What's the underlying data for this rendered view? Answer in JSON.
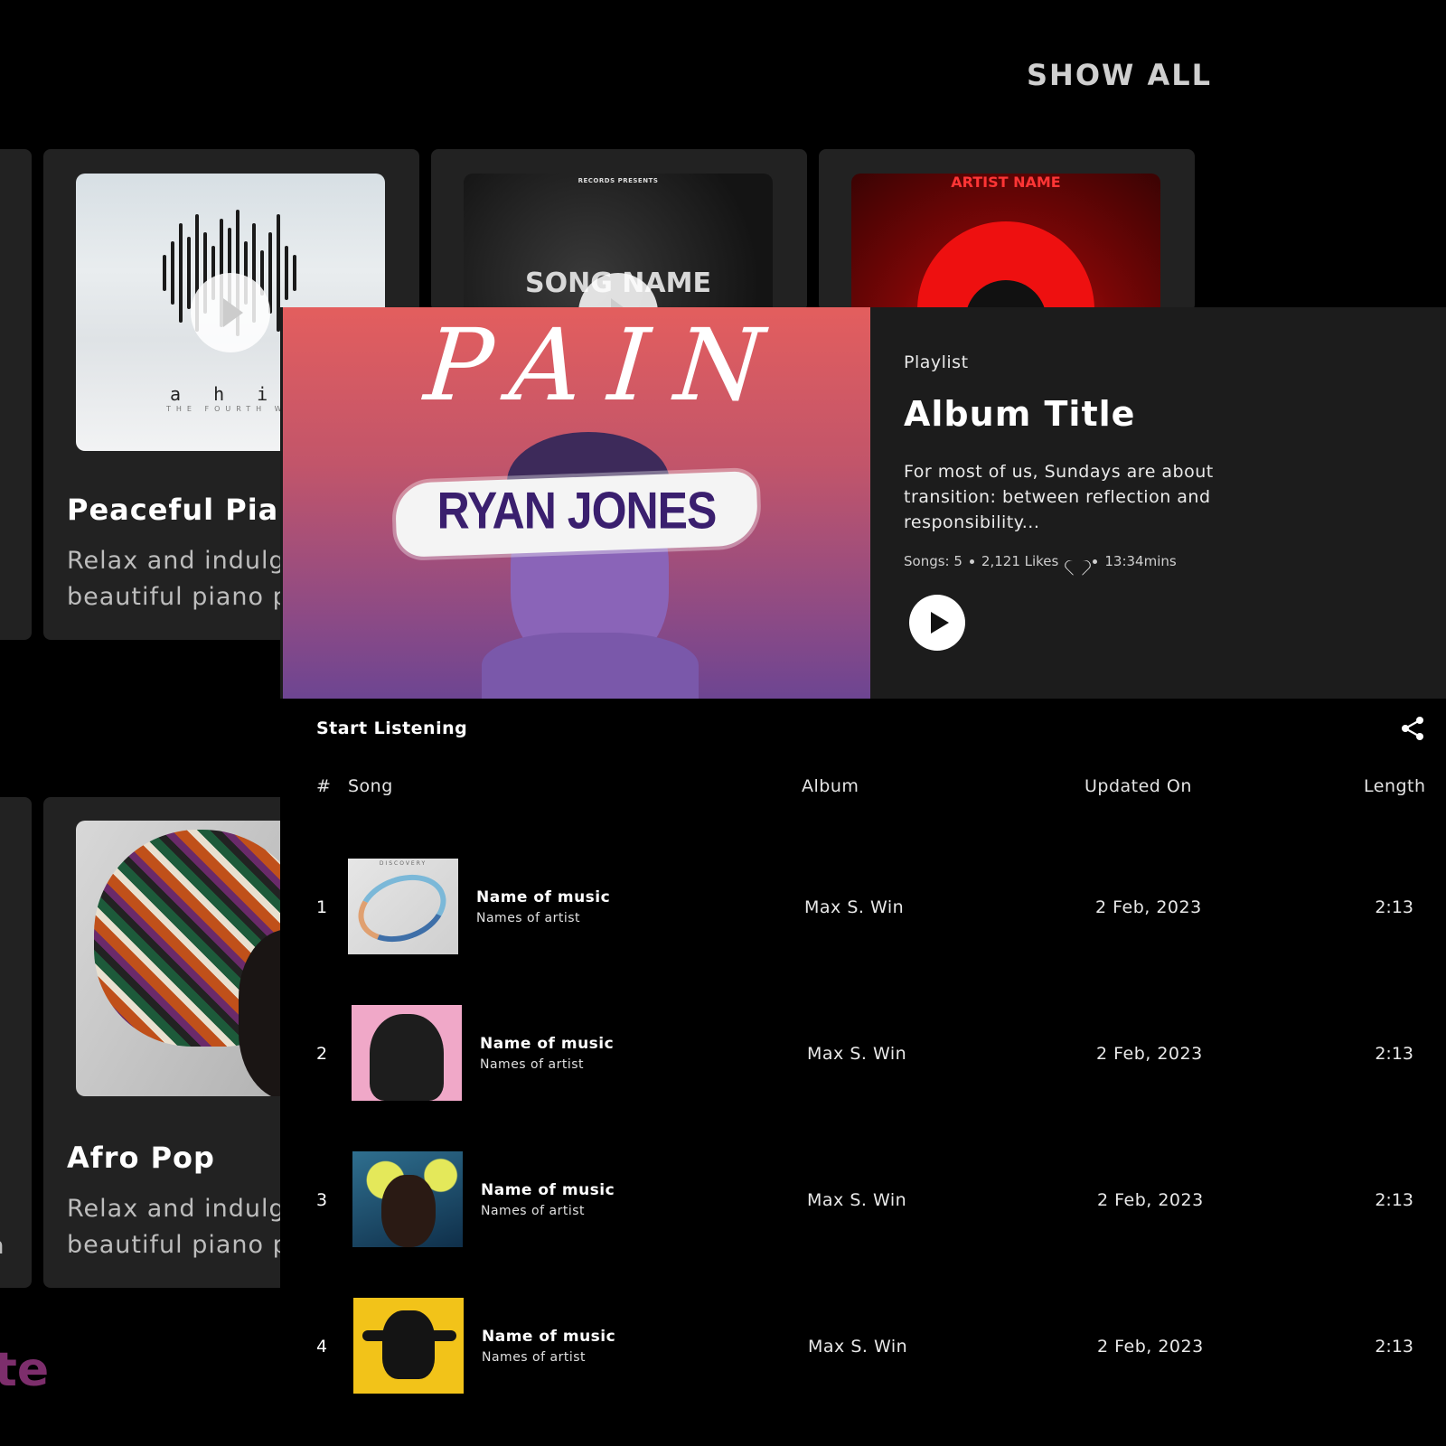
{
  "background": {
    "show_all": "SHOW ALL",
    "cards": [
      {
        "title": "Peaceful Piar",
        "desc_line1": "Relax and indulg",
        "desc_line2": "beautiful piano p",
        "cover_text": "a h i m s",
        "cover_subtext": "THE FOURTH WA"
      },
      {
        "cover_top": "RECORDS PRESENTS",
        "cover_main": "SONG NAME"
      },
      {
        "cover_top": "ARTIST NAME"
      },
      {
        "title": "Afro Pop",
        "desc_line1": "Relax and indulg",
        "desc_line2": "beautiful piano p"
      }
    ],
    "orphan_text": "n",
    "heading_fragment": "te"
  },
  "playlist": {
    "cover_script": "PAIN",
    "cover_artist": "RYAN JONES",
    "kind": "Playlist",
    "title": "Album Title",
    "description": "For most of us, Sundays are about transition: between reflection and responsibility...",
    "stats": {
      "songs": "Songs: 5",
      "likes": "2,121 Likes",
      "duration": "13:34mins"
    }
  },
  "list": {
    "heading": "Start Listening",
    "columns": {
      "index": "#",
      "song": "Song",
      "album": "Album",
      "updated": "Updated On",
      "length": "Length"
    },
    "rows": [
      {
        "num": "1",
        "song": "Name of music",
        "artist": "Names of artist",
        "album": "Max S. Win",
        "date": "2 Feb, 2023",
        "length": "2:13",
        "thumb_tag": "DISCOVERY"
      },
      {
        "num": "2",
        "song": "Name of music",
        "artist": "Names of artist",
        "album": "Max S. Win",
        "date": "2 Feb, 2023",
        "length": "2:13"
      },
      {
        "num": "3",
        "song": "Name of music",
        "artist": "Names of artist",
        "album": "Max S. Win",
        "date": "2 Feb, 2023",
        "length": "2:13"
      },
      {
        "num": "4",
        "song": "Name of music",
        "artist": "Names of artist",
        "album": "Max S. Win",
        "date": "2 Feb, 2023",
        "length": "2:13"
      }
    ]
  },
  "icons": {
    "play": "play-icon",
    "heart": "heart-icon",
    "share": "share-icon"
  },
  "colors": {
    "background": "#000000",
    "card": "#222222",
    "panel_header": "#1c1c1c",
    "text": "#ffffff",
    "muted": "#bdbdbd",
    "accent_heading": "#7d2e6c"
  }
}
